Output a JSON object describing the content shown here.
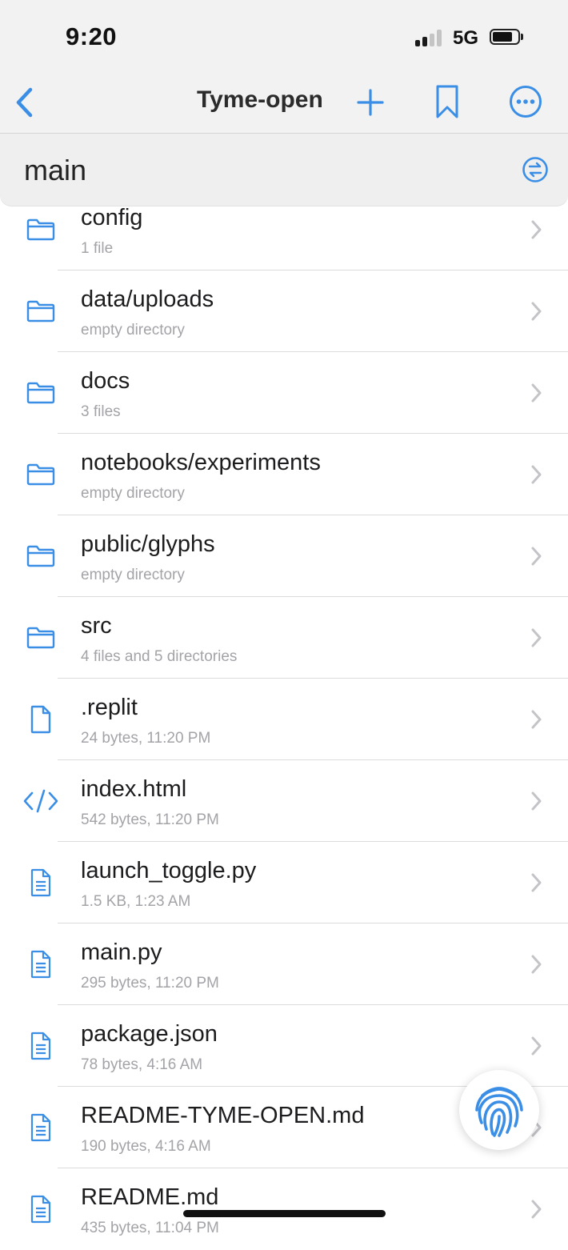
{
  "status_bar": {
    "time": "9:20",
    "network": "5G"
  },
  "nav": {
    "title": "Tyme-open"
  },
  "branch": {
    "name": "main"
  },
  "files": [
    {
      "name": "config",
      "meta": "1 file",
      "icon": "folder-icon"
    },
    {
      "name": "data/uploads",
      "meta": "empty directory",
      "icon": "folder-icon"
    },
    {
      "name": "docs",
      "meta": "3 files",
      "icon": "folder-icon"
    },
    {
      "name": "notebooks/experiments",
      "meta": "empty directory",
      "icon": "folder-icon"
    },
    {
      "name": "public/glyphs",
      "meta": "empty directory",
      "icon": "folder-icon"
    },
    {
      "name": "src",
      "meta": "4 files and 5 directories",
      "icon": "folder-icon"
    },
    {
      "name": ".replit",
      "meta": "24 bytes, 11:20 PM",
      "icon": "file-icon"
    },
    {
      "name": "index.html",
      "meta": "542 bytes, 11:20 PM",
      "icon": "code-icon"
    },
    {
      "name": "launch_toggle.py",
      "meta": "1.5 KB, 1:23 AM",
      "icon": "text-file-icon"
    },
    {
      "name": "main.py",
      "meta": "295 bytes, 11:20 PM",
      "icon": "text-file-icon"
    },
    {
      "name": "package.json",
      "meta": "78 bytes, 4:16 AM",
      "icon": "text-file-icon"
    },
    {
      "name": "README-TYME-OPEN.md",
      "meta": "190 bytes, 4:16 AM",
      "icon": "text-file-icon"
    },
    {
      "name": "README.md",
      "meta": "435 bytes, 11:04 PM",
      "icon": "text-file-icon"
    }
  ],
  "colors": {
    "accent": "#3a8ee6",
    "chevron": "#c4c4c8",
    "meta_text": "#a3a3a8"
  }
}
